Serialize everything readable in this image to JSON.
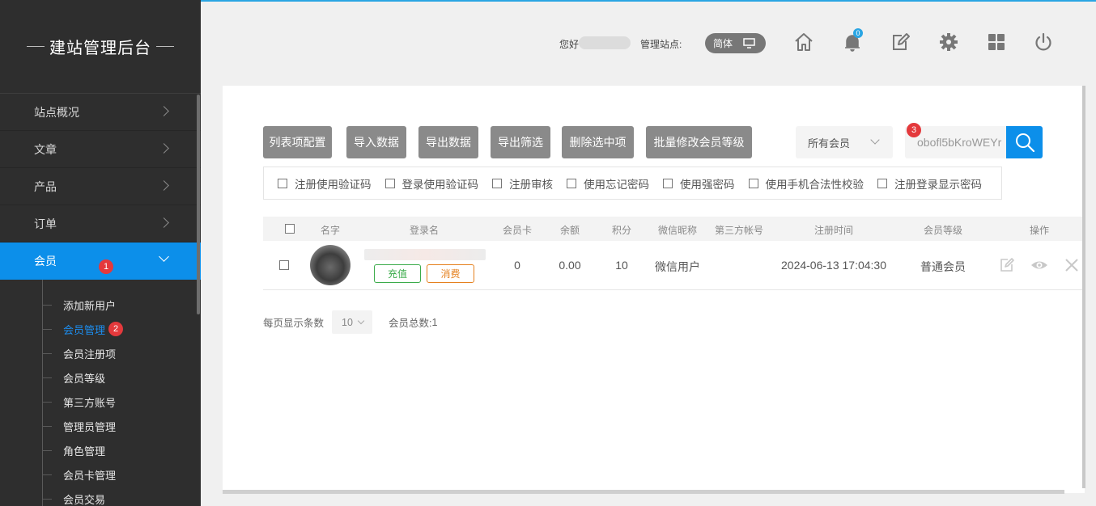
{
  "sidebar": {
    "brand": "建站管理后台",
    "items": [
      {
        "label": "站点概况"
      },
      {
        "label": "文章"
      },
      {
        "label": "产品"
      },
      {
        "label": "订单"
      },
      {
        "label": "会员",
        "badge": "1"
      }
    ],
    "sub_items": [
      {
        "label": "添加新用户"
      },
      {
        "label": "会员管理",
        "badge": "2"
      },
      {
        "label": "会员注册项"
      },
      {
        "label": "会员等级"
      },
      {
        "label": "第三方账号"
      },
      {
        "label": "管理员管理"
      },
      {
        "label": "角色管理"
      },
      {
        "label": "会员卡管理"
      },
      {
        "label": "会员交易"
      }
    ]
  },
  "header": {
    "greeting": "您好",
    "site_label": "管理站点:",
    "language": "简体",
    "notification_count": "0",
    "icons": [
      "home-icon",
      "bell-icon",
      "edit-icon",
      "gear-icon",
      "grid-icon",
      "power-icon"
    ]
  },
  "toolbar": {
    "buttons": [
      "列表项配置",
      "导入数据",
      "导出数据",
      "导出筛选",
      "删除选中项",
      "批量修改会员等级"
    ],
    "member_filter": "所有会员",
    "search_value": "obofl5bKroWEYr",
    "search_badge": "3"
  },
  "options": [
    "注册使用验证码",
    "登录使用验证码",
    "注册审核",
    "使用忘记密码",
    "使用强密码",
    "使用手机合法性校验",
    "注册登录显示密码"
  ],
  "table": {
    "headers": [
      "名字",
      "登录名",
      "会员卡",
      "余额",
      "积分",
      "微信昵称",
      "第三方帐号",
      "注册时间",
      "会员等级",
      "操作"
    ],
    "rows": [
      {
        "recharge": "充值",
        "consume": "消费",
        "card": "0",
        "balance": "0.00",
        "points": "10",
        "wechat": "微信用户",
        "third": "",
        "time": "2024-06-13 17:04:30",
        "level": "普通会员"
      }
    ]
  },
  "pager": {
    "per_page_label": "每页显示条数",
    "per_page": "10",
    "total_label": "会员总数:",
    "total": "1"
  },
  "colors": {
    "accent": "#0c8fea",
    "sidebar_bg": "#2e2e2e",
    "badge": "#e4393c",
    "button_gray": "#8a8a8a"
  }
}
